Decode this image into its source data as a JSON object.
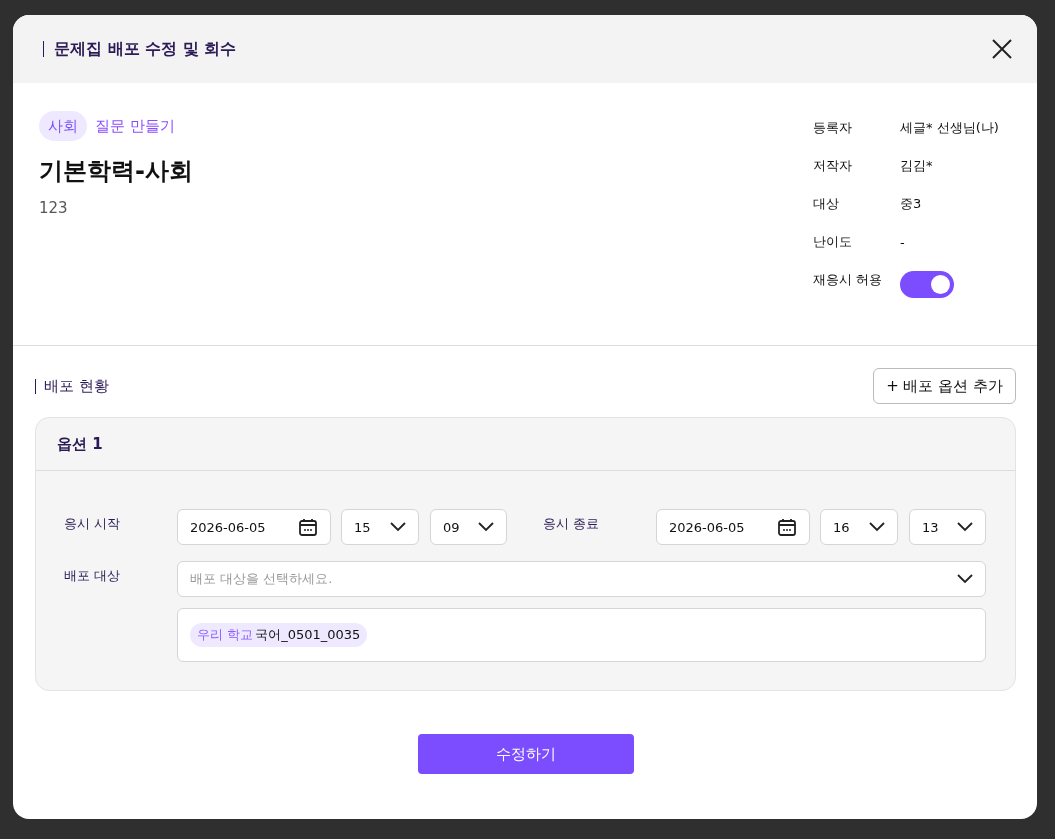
{
  "dialog": {
    "title": "문제집 배포 수정 및 회수"
  },
  "summary": {
    "subject_tag": "사회",
    "link": "질문 만들기",
    "title": "기본학력-사회",
    "description": "123"
  },
  "info": [
    {
      "label": "등록자",
      "value": "세글* 선생님(나)"
    },
    {
      "label": "저작자",
      "value": "김김*"
    },
    {
      "label": "대상",
      "value": "중3"
    },
    {
      "label": "난이도",
      "value": "-"
    }
  ],
  "retake": {
    "label": "재응시 허용",
    "on": true
  },
  "distribution": {
    "heading": "배포 현황",
    "add_button": "+ 배포 옵션 추가",
    "options": [
      {
        "title": "옵션 1",
        "start": {
          "label": "응시 시작",
          "date": "2026-06-05",
          "hour": "15",
          "minute": "09"
        },
        "end": {
          "label": "응시 종료",
          "date": "2026-06-05",
          "hour": "16",
          "minute": "13"
        },
        "target": {
          "label": "배포 대상",
          "placeholder": "배포 대상을 선택하세요.",
          "chips": [
            {
              "tag": "우리 학교",
              "name": "국어_0501_0035"
            }
          ]
        }
      }
    ]
  },
  "submit": "수정하기"
}
